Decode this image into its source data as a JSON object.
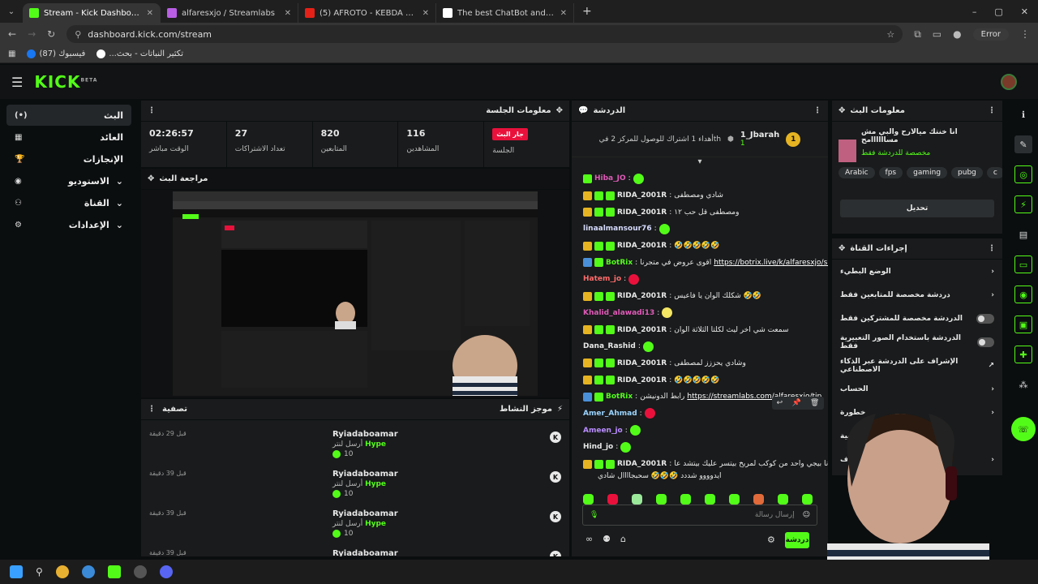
{
  "browser": {
    "tabs": [
      {
        "label": "Stream - Kick Dashboard",
        "fav": "#53fc18",
        "active": true
      },
      {
        "label": "alfaresxjo / Streamlabs",
        "fav": "#b95ee5",
        "active": false
      },
      {
        "label": "(5) AFROTO - KEBDA FT ONUY |",
        "fav": "#e62117",
        "active": false
      },
      {
        "label": "The best ChatBot and Widgets",
        "fav": "#ffffff",
        "active": false
      }
    ],
    "url": "dashboard.kick.com/stream",
    "profile_status": "Error",
    "bookmarks": [
      "(87) فيسبوك",
      "...تكثير النباتات - بحث"
    ]
  },
  "header": {
    "logo": "KICK",
    "logo_sup": "BETA"
  },
  "sidebar": {
    "items": [
      {
        "label": "البث",
        "icon": "(•)",
        "active": true
      },
      {
        "label": "العائد",
        "icon": "▦",
        "active": false
      },
      {
        "label": "الإنجازات",
        "icon": "🏆",
        "active": false
      },
      {
        "label": "الاستوديو",
        "icon": "◉",
        "active": false,
        "chevron": true
      },
      {
        "label": "القناة",
        "icon": "⚇",
        "active": false,
        "chevron": true
      },
      {
        "label": "الإعدادات",
        "icon": "⚙",
        "active": false,
        "chevron": true
      }
    ]
  },
  "session": {
    "title": "معلومات الجلسة",
    "stats": [
      {
        "value": "02:26:57",
        "label": "الوقت مباشر"
      },
      {
        "value": "27",
        "label": "تعداد الاشتراكات"
      },
      {
        "value": "820",
        "label": "المتابعين"
      },
      {
        "value": "116",
        "label": "المشاهدين"
      }
    ],
    "live_badge": "جار البث",
    "session_label": "الجلسة"
  },
  "preview": {
    "title": "مراجعة البث"
  },
  "activity": {
    "title": "موجز النشاط",
    "filter_label": "تصفية",
    "items": [
      {
        "name": "Ryiadaboamar",
        "sent": "أرسل لنتر",
        "kind": "Hype",
        "count": "10",
        "time": "قبل 29 دقيقة"
      },
      {
        "name": "Ryiadaboamar",
        "sent": "أرسل لنتر",
        "kind": "Hype",
        "count": "10",
        "time": "قبل 39 دقيقة"
      },
      {
        "name": "Ryiadaboamar",
        "sent": "أرسل لنتر",
        "kind": "Hype",
        "count": "10",
        "time": "قبل 39 دقيقة"
      },
      {
        "name": "Ryiadaboamar",
        "sent": "",
        "kind": "",
        "count": "",
        "time": "قبل 39 دقيقة"
      }
    ]
  },
  "chat": {
    "title": "الدردشة",
    "pinned_user": "1_Jbarah",
    "pinned_rank": "1",
    "pinned_count": "1",
    "pinned_text": "أهداء 1 اشتراك للوصول للمركز 2 فيth",
    "messages": [
      {
        "user": "Hiba_JO",
        "color": "#e05ab8",
        "badges": [
          "g"
        ],
        "text": "",
        "emote": "#53fc18"
      },
      {
        "user": "RIDA_2001R",
        "color": "#e8e8e8",
        "badges": [
          "crown",
          "g",
          "g"
        ],
        "text": "شادي ومصطفى",
        "emote": ""
      },
      {
        "user": "RIDA_2001R",
        "color": "#e8e8e8",
        "badges": [
          "crown",
          "g",
          "g"
        ],
        "text": "ومصطفى قل حب ١٢",
        "emote": ""
      },
      {
        "user": "linaalmansour76",
        "color": "#d8dcff",
        "badges": [],
        "text": "",
        "emote": "#53fc18"
      },
      {
        "user": "RIDA_2001R",
        "color": "#e8e8e8",
        "badges": [
          "crown",
          "g",
          "g"
        ],
        "text": "🤣🤣🤣🤣🤣",
        "emote": ""
      },
      {
        "user": "BotRix",
        "color": "#53fc18",
        "badges": [
          "b",
          "g"
        ],
        "text": "اقوى عروض في متجرنا",
        "link": "https://botrix.live/k/alfaresxjo/shop"
      },
      {
        "user": "Hatem_jo",
        "color": "#ff6b6b",
        "badges": [],
        "text": "",
        "emote": "#e9113c"
      },
      {
        "user": "RIDA_2001R",
        "color": "#e8e8e8",
        "badges": [
          "crown",
          "g",
          "g"
        ],
        "text": "شكلك الوان يا فاعيس 🤣🤣",
        "emote": ""
      },
      {
        "user": "Khalid_alawadi13",
        "color": "#e05ab8",
        "badges": [],
        "text": "",
        "emote": "#f5e663"
      },
      {
        "user": "RIDA_2001R",
        "color": "#e8e8e8",
        "badges": [
          "crown",
          "g",
          "g"
        ],
        "text": "سمعت شي اخر ليث لكلتا الثلاثة الوان",
        "emote": ""
      },
      {
        "user": "Dana_Rashid",
        "color": "#e8e8e8",
        "badges": [],
        "text": "",
        "emote": "#53fc18"
      },
      {
        "user": "RIDA_2001R",
        "color": "#e8e8e8",
        "badges": [
          "crown",
          "g",
          "g"
        ],
        "text": "وشادي يحززز لمصطفى",
        "emote": ""
      },
      {
        "user": "RIDA_2001R",
        "color": "#e8e8e8",
        "badges": [
          "crown",
          "g",
          "g"
        ],
        "text": "🤣🤣🤣🤣🤣",
        "emote": ""
      },
      {
        "user": "BotRix",
        "color": "#53fc18",
        "badges": [
          "b",
          "g"
        ],
        "text": "رابط الدونيشن",
        "link": "https://streamlabs.com/alfaresxjo/tip"
      },
      {
        "user": "Amer_Ahmad",
        "color": "#9bd4ff",
        "badges": [],
        "text": "",
        "emote": "#e9113c"
      },
      {
        "user": "Ameen_jo",
        "color": "#b98cff",
        "badges": [],
        "text": "",
        "emote": "#53fc18"
      },
      {
        "user": "Hind_jo",
        "color": "#e8e8e8",
        "badges": [],
        "text": "",
        "emote": "#53fc18"
      },
      {
        "user": "RIDA_2001R",
        "color": "#e8e8e8",
        "badges": [
          "crown",
          "g",
          "g"
        ],
        "text": "شادي انا بيجي واحد من كوكب لمريخ بيتسر عليك بيتشد عا",
        "emote": ""
      }
    ],
    "last_line": "ايدوووو شددد 🤣🤣🤣 سحبجاااال شادي",
    "emote_colors": [
      "#53fc18",
      "#e9113c",
      "#9be89b",
      "#53fc18",
      "#53fc18",
      "#53fc18",
      "#53fc18",
      "#e06a3a",
      "#53fc18",
      "#53fc18"
    ],
    "input_placeholder": "إرسال رسالة",
    "send_label": "دردشة"
  },
  "stream_info": {
    "title": "معلومات البث",
    "stream_title": "انا خنتك ميالارح والبي مش مساااااامح",
    "category": "مخصصة للدردشة فقط",
    "tags": [
      "Arabic",
      "fps",
      "gaming",
      "pubg",
      "c"
    ],
    "edit_button": "تحديل"
  },
  "channel_actions": {
    "title": "إجراءات القناة",
    "rows": [
      {
        "label": "الوضع البطيء",
        "control": "chevron"
      },
      {
        "label": "دردشة مخصصة للمتابعين فقط",
        "control": "chevron"
      },
      {
        "label": "الدردشة مخصصة للمشتركين فقط",
        "control": "toggle"
      },
      {
        "label": "الدردشة باستخدام الصور التعبيرية فقط",
        "control": "toggle"
      },
      {
        "label": "الإشراف على الدردشة عبر الذكاء الاصطناعي",
        "control": "external"
      },
      {
        "label": "الحساب",
        "control": "chevron"
      },
      {
        "label": "خطورة",
        "control": "chevron"
      },
      {
        "label": "القناة الشخصية",
        "control": ""
      },
      {
        "label": "أهداف",
        "control": "chevron"
      }
    ]
  }
}
